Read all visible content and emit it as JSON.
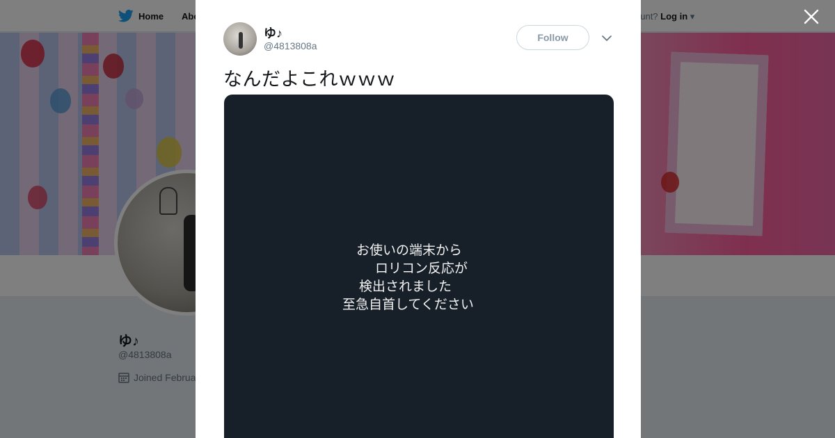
{
  "topbar": {
    "home_label": "Home",
    "about_label": "Abo",
    "login_prompt": "ccount?",
    "login_label": "Log in"
  },
  "profile": {
    "name": "ゆ♪",
    "handle": "@4813808a",
    "joined": "Joined Februa"
  },
  "modal": {
    "author_name": "ゆ♪",
    "author_handle": "@4813808a",
    "follow_label": "Follow",
    "tweet_text": "なんだよこれｗｗｗ",
    "media_lines": [
      "お使いの端末から",
      "ロリコン反応が",
      "検出されました",
      "至急自首してください"
    ]
  },
  "colors": {
    "brand_blue": "#1da1f2",
    "media_bg": "#171f28",
    "overlay": "rgba(0,0,0,0.5)"
  },
  "icons": {
    "home": "bird-icon",
    "close": "close-icon",
    "caret": "chevron-down-icon",
    "calendar": "calendar-icon"
  }
}
